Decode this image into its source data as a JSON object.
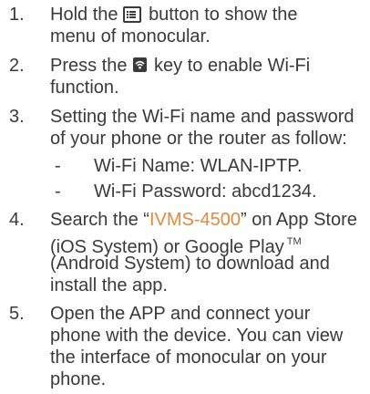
{
  "steps": [
    {
      "number": "1.",
      "line1_before": "Hold the",
      "line1_after": "button to show the",
      "line2": "menu of monocular.",
      "icon": "menu-button-icon"
    },
    {
      "number": "2.",
      "line1_before": "Press the",
      "line1_after": "key to enable Wi-Fi",
      "line2": "function.",
      "icon": "wifi-key-icon"
    },
    {
      "number": "3.",
      "line1": "Setting the Wi-Fi name and password",
      "line2": "of your phone or the router as follow:",
      "sub_items": [
        {
          "dash": "-",
          "text": "Wi-Fi Name: WLAN-IPTP."
        },
        {
          "dash": "-",
          "text": "Wi-Fi Password: abcd1234."
        }
      ]
    },
    {
      "number": "4.",
      "line1_before": "Search the “",
      "app_name": "IVMS-4500",
      "line1_after": "” on App Store",
      "line2_before": "(iOS System) or Google Play",
      "trademark": "TM",
      "line3": "(Android System) to download and",
      "line4": "install the app."
    },
    {
      "number": "5.",
      "line1": "Open the APP and connect your",
      "line2": "phone with the device. You can view",
      "line3": "the interface of monocular on your",
      "line4": "phone."
    }
  ],
  "colors": {
    "text": "#3a3a3a",
    "highlight": "#e38a3e"
  }
}
